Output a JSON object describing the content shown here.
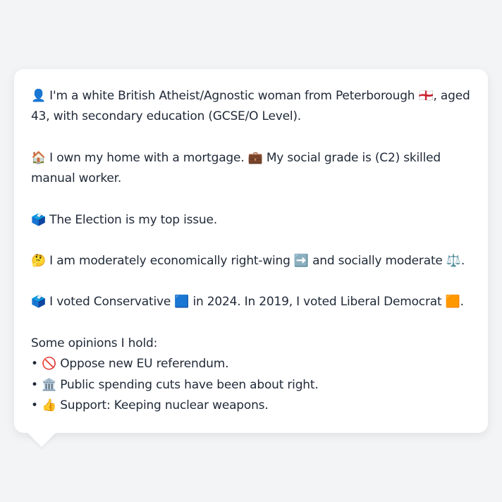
{
  "profile": {
    "identity": "👤 I'm a white British Atheist/Agnostic woman from Peterborough 🏴󠁧󠁢󠁥󠁮󠁧󠁿, aged 43, with secondary education (GCSE/O Level).",
    "home": "🏠 I own my home with a mortgage. 💼 My social grade is (C2) skilled manual worker.",
    "top_issue": "🗳️ The Election is my top issue.",
    "ideology": "🤔 I am moderately economically right-wing ➡️ and socially moderate ⚖️.",
    "votes": "🗳️ I voted Conservative 🟦 in 2024. In 2019, I voted Liberal Democrat 🟧.",
    "opinions_heading": "Some opinions I hold:",
    "opinions": [
      "• 🚫 Oppose new EU referendum.",
      "• 🏛️ Public spending cuts have been about right.",
      "• 👍 Support: Keeping nuclear weapons."
    ]
  }
}
